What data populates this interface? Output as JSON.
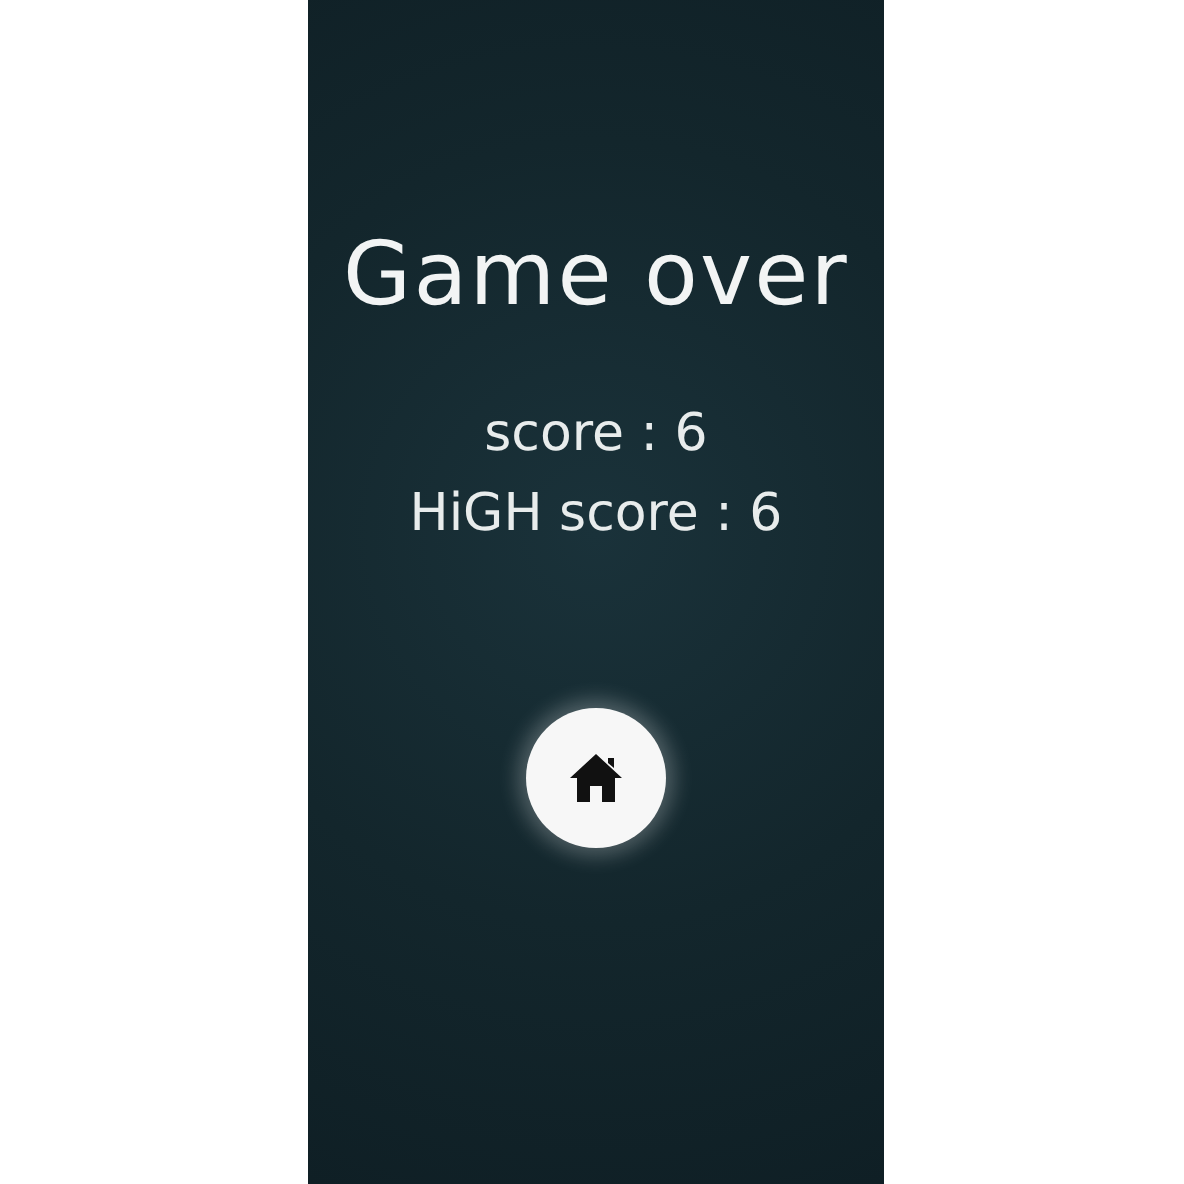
{
  "title": "Game over",
  "scores": [
    {
      "label": "score",
      "value": "6"
    },
    {
      "label": "HiGH score",
      "value": "6"
    }
  ],
  "separator": ":",
  "home_button": {
    "kind": "home"
  }
}
